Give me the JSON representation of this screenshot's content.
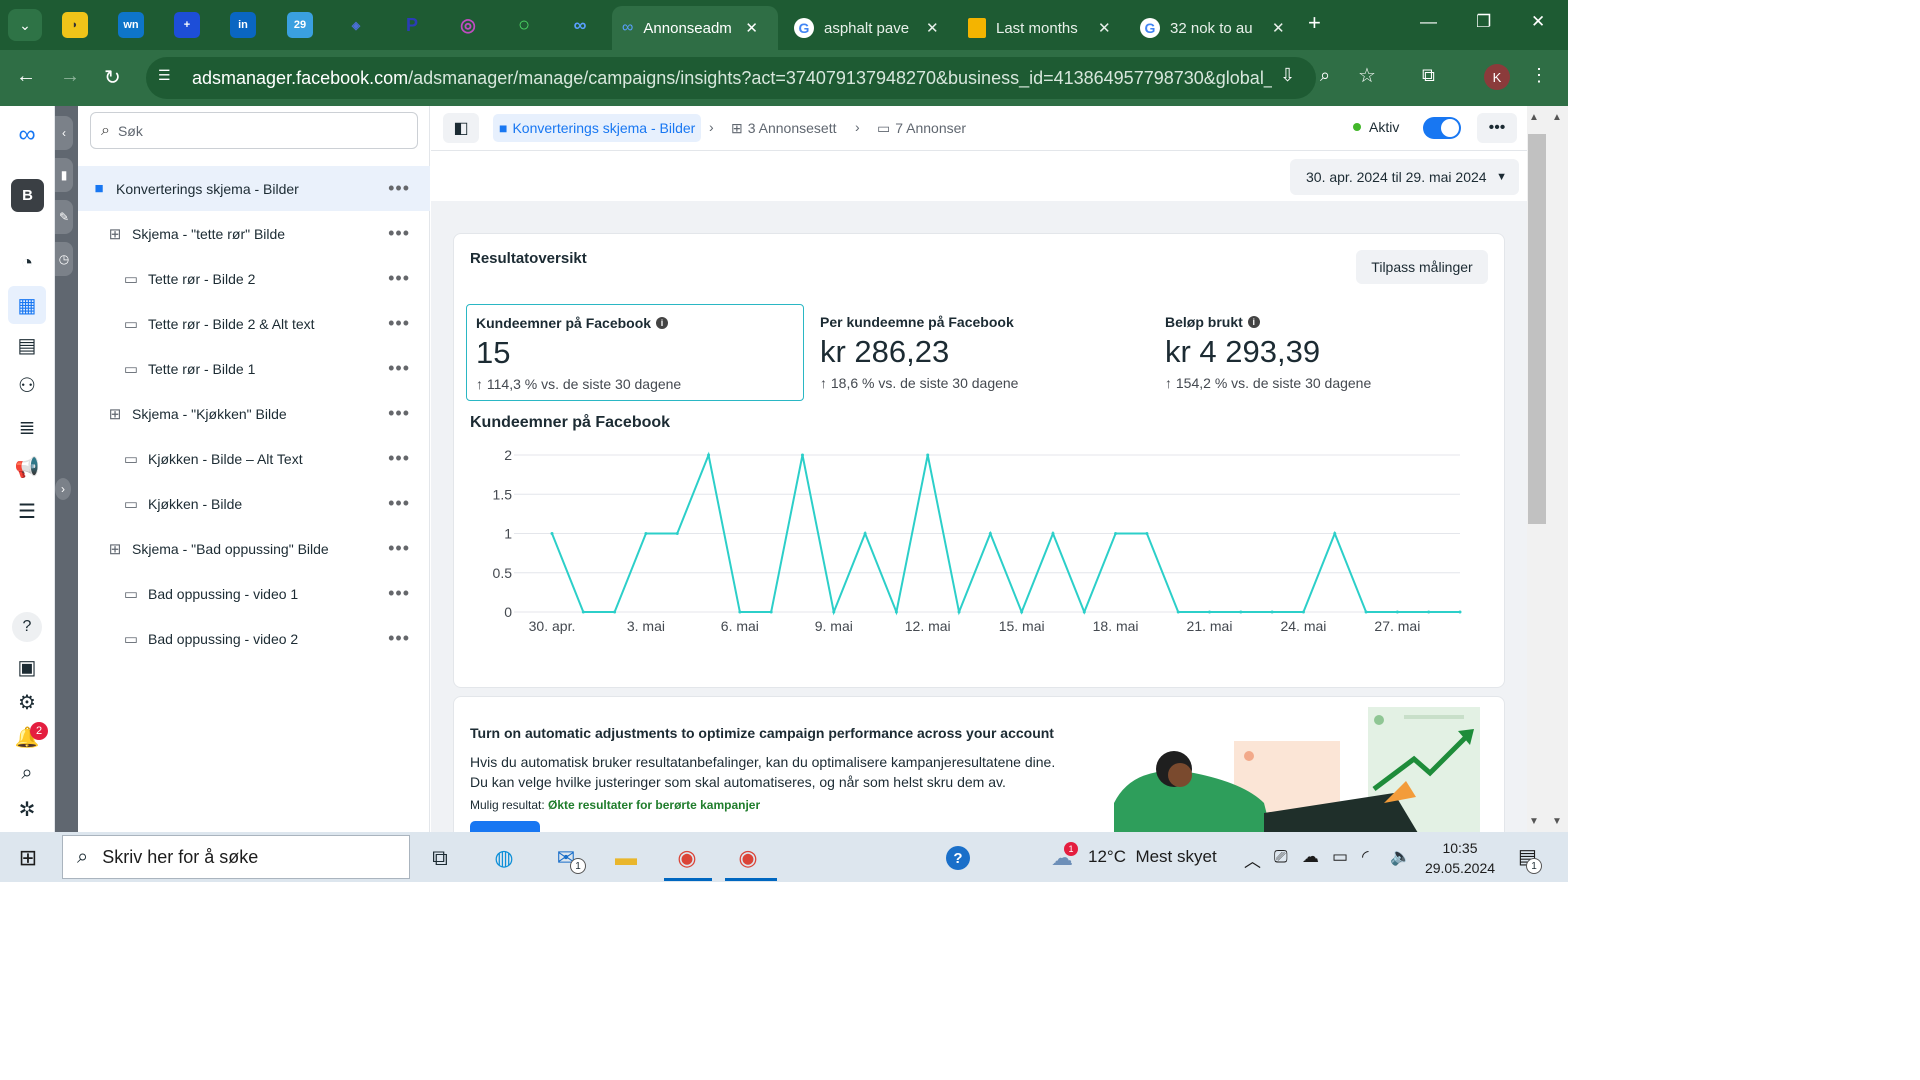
{
  "browser": {
    "tabs": [
      {
        "title": "Annonseadm",
        "active": true
      },
      {
        "title": "asphalt pave",
        "active": false
      },
      {
        "title": "Last months",
        "active": false
      },
      {
        "title": "32 nok to au",
        "active": false
      }
    ],
    "pinned_labels": [
      "wn",
      "29"
    ],
    "url_host": "adsmanager.facebook.com",
    "url_path": "/adsmanager/manage/campaigns/insights?act=374079137948270&business_id=413864957798730&global_scop…",
    "profile_initial": "K"
  },
  "rail": {
    "account_initial": "B",
    "notification_count": "2"
  },
  "tree": {
    "search_placeholder": "Søk",
    "items": [
      {
        "label": "Konverterings skjema - Bilder",
        "type": "campaign"
      },
      {
        "label": "Skjema - \"tette rør\" Bilde",
        "type": "adset"
      },
      {
        "label": "Tette rør - Bilde 2",
        "type": "ad"
      },
      {
        "label": "Tette rør - Bilde 2 & Alt text",
        "type": "ad"
      },
      {
        "label": "Tette rør - Bilde 1",
        "type": "ad"
      },
      {
        "label": "Skjema - \"Kjøkken\" Bilde",
        "type": "adset"
      },
      {
        "label": "Kjøkken - Bilde – Alt Text",
        "type": "ad"
      },
      {
        "label": "Kjøkken - Bilde",
        "type": "ad"
      },
      {
        "label": "Skjema - \"Bad oppussing\" Bilde",
        "type": "adset"
      },
      {
        "label": "Bad oppussing - video 1",
        "type": "ad"
      },
      {
        "label": "Bad oppussing - video 2",
        "type": "ad"
      }
    ]
  },
  "topbar": {
    "crumb_campaign": "Konverterings skjema - Bilder",
    "crumb_adsets": "3 Annonsesett",
    "crumb_ads": "7 Annonser",
    "status": "Aktiv"
  },
  "date_range": "30. apr. 2024 til 29. mai 2024",
  "overview": {
    "title": "Resultatoversikt",
    "customize_label": "Tilpass målinger",
    "metrics": [
      {
        "label": "Kundeemner på Facebook",
        "value": "15",
        "change": "114,3 % vs. de siste 30 dagene",
        "info": true
      },
      {
        "label": "Per kundeemne på Facebook",
        "value": "kr 286,23",
        "change": "18,6 % vs. de siste 30 dagene",
        "info": false
      },
      {
        "label": "Beløp brukt",
        "value": "kr 4 293,39",
        "change": "154,2 % vs. de siste 30 dagene",
        "info": true
      }
    ]
  },
  "chart_data": {
    "type": "line",
    "title": "Kundeemner på Facebook",
    "x": [
      "30. apr.",
      "1. mai",
      "2. mai",
      "3. mai",
      "4. mai",
      "5. mai",
      "6. mai",
      "7. mai",
      "8. mai",
      "9. mai",
      "10. mai",
      "11. mai",
      "12. mai",
      "13. mai",
      "14. mai",
      "15. mai",
      "16. mai",
      "17. mai",
      "18. mai",
      "19. mai",
      "20. mai",
      "21. mai",
      "22. mai",
      "23. mai",
      "24. mai",
      "25. mai",
      "26. mai",
      "27. mai",
      "28. mai",
      "29. mai"
    ],
    "x_tick_labels": [
      "30. apr.",
      "3. mai",
      "6. mai",
      "9. mai",
      "12. mai",
      "15. mai",
      "18. mai",
      "21. mai",
      "24. mai",
      "27. mai"
    ],
    "series": [
      {
        "values": [
          1,
          0,
          0,
          1,
          1,
          2,
          0,
          0,
          2,
          0,
          1,
          0,
          2,
          0,
          1,
          0,
          1,
          0,
          1,
          1,
          0,
          0,
          0,
          0,
          0,
          1,
          0,
          0,
          0,
          0
        ]
      }
    ],
    "y_ticks": [
      "0",
      "0.5",
      "1",
      "1.5",
      "2"
    ],
    "ylim": [
      0,
      2
    ],
    "grid": true,
    "color": "#2ccfc9"
  },
  "banner": {
    "title": "Turn on automatic adjustments to optimize campaign performance across your account",
    "text": "Hvis du automatisk bruker resultatanbefalinger, kan du optimalisere kampanjeresultatene dine. Du kan velge hvilke justeringer som skal automatiseres, og når som helst skru dem av.",
    "result_prefix": "Mulig resultat:",
    "result_value": "Økte resultater for berørte kampanjer"
  },
  "taskbar": {
    "search_placeholder": "Skriv her for å søke",
    "weather_badge": "1",
    "temperature": "12°C",
    "weather": "Mest skyet",
    "mail_badge": "1",
    "time": "10:35",
    "date": "29.05.2024",
    "notification_count": "1"
  }
}
